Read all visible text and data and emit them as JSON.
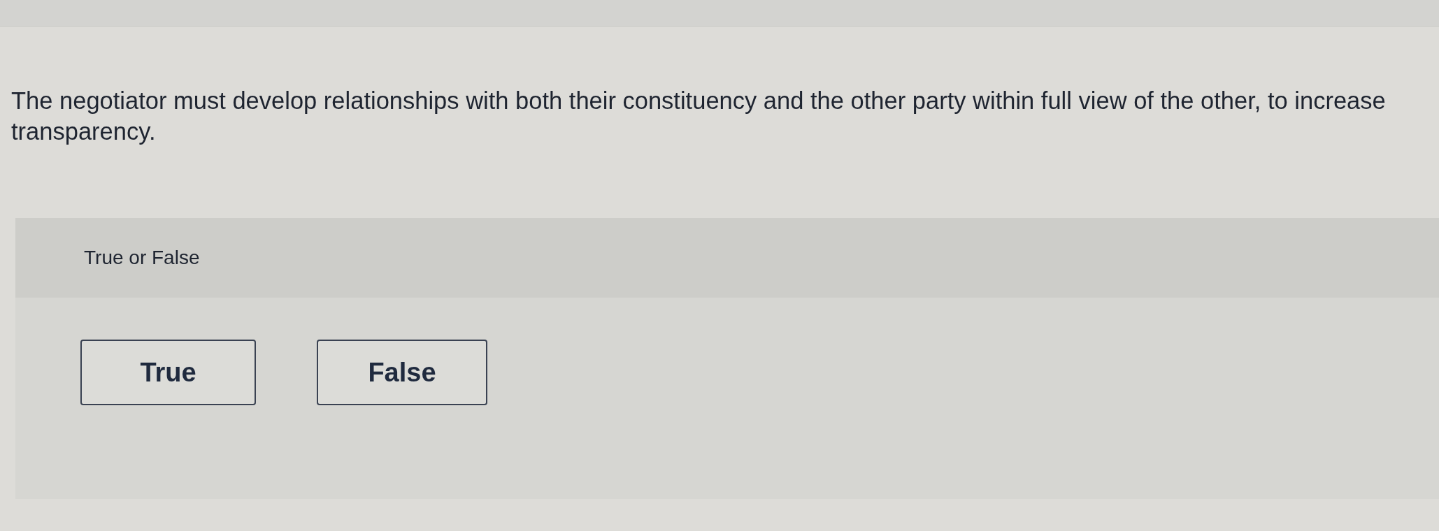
{
  "question": {
    "text": "The negotiator must develop relationships with both their constituency and the other party within full view of the other, to increase transparency."
  },
  "answer_panel": {
    "prompt": "True or False",
    "options": [
      {
        "label": "True",
        "selected": false
      },
      {
        "label": "False",
        "selected": false
      }
    ]
  }
}
